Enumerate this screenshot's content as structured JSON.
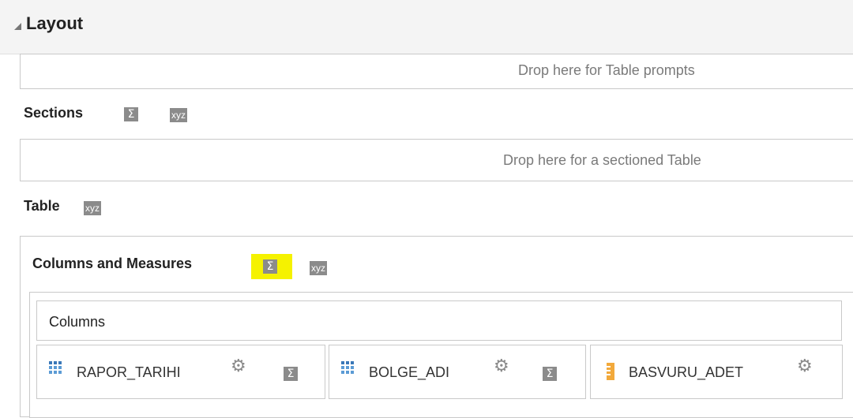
{
  "header": {
    "title": "Layout"
  },
  "table_prompts": {
    "hint": "Drop here for Table prompts"
  },
  "sections": {
    "label": "Sections",
    "sigma": "Σ",
    "xyz": "xyz",
    "hint": "Drop here for a sectioned Table"
  },
  "table": {
    "label": "Table",
    "xyz": "xyz"
  },
  "columns_and_measures": {
    "label": "Columns and Measures",
    "sigma": "Σ",
    "xyz": "xyz",
    "highlight_color": "#f5f200"
  },
  "columns": {
    "header": "Columns",
    "items": [
      {
        "name": "RAPOR_TARIHI",
        "type_icon": "attribute-grid-icon",
        "gear": "⚙",
        "sigma": "Σ"
      },
      {
        "name": "BOLGE_ADI",
        "type_icon": "attribute-grid-icon",
        "gear": "⚙",
        "sigma": "Σ"
      },
      {
        "name": "BASVURU_ADET",
        "type_icon": "measure-ruler-icon",
        "gear": "⚙"
      }
    ]
  },
  "colors": {
    "header_bg": "#f4f4f4",
    "border": "#c9c9c9",
    "hint_text": "#7a7a7a",
    "icon_gray": "#8b8b8b",
    "attribute_blue": "#5b9bd5",
    "measure_orange": "#f2a93b"
  }
}
